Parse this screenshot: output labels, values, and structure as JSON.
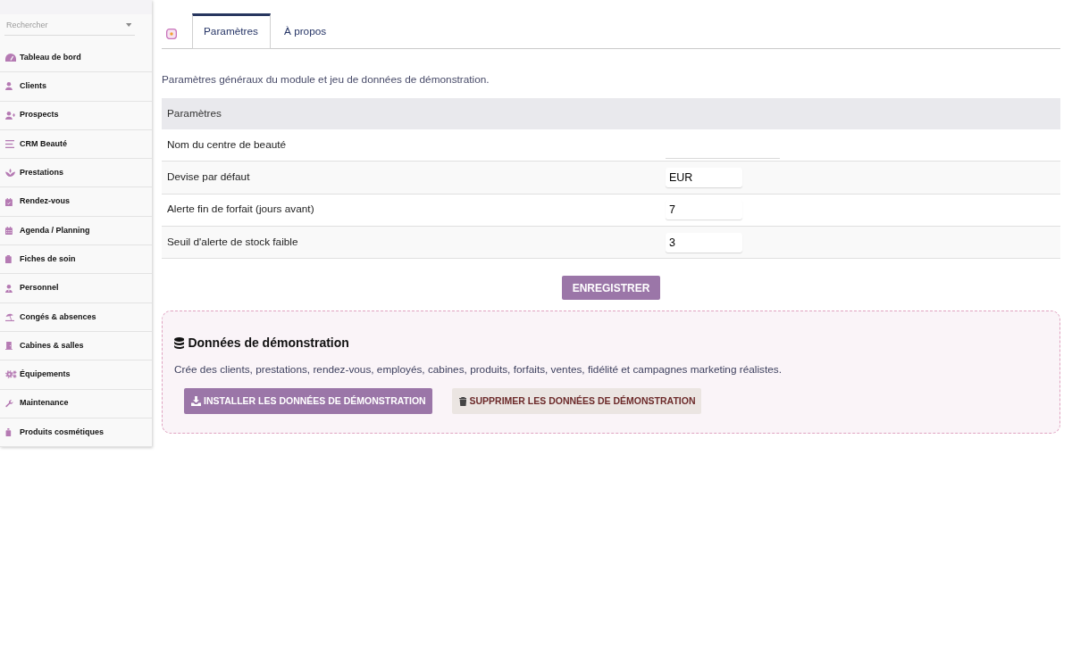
{
  "sidebar": {
    "search": {
      "placeholder": "Rechercher"
    },
    "items": [
      {
        "label": "Tableau de bord",
        "selected": false
      },
      {
        "label": "Clients",
        "selected": false
      },
      {
        "label": "Prospects",
        "selected": false
      },
      {
        "label": "CRM Beauté",
        "selected": false
      },
      {
        "label": "Prestations",
        "selected": false
      },
      {
        "label": "Rendez-vous",
        "selected": false
      },
      {
        "label": "Agenda / Planning",
        "selected": false
      },
      {
        "label": "Fiches de soin",
        "selected": false
      },
      {
        "label": "Personnel",
        "selected": false
      },
      {
        "label": "Congés & absences",
        "selected": false
      },
      {
        "label": "Cabines & salles",
        "selected": false
      },
      {
        "label": "Équipements",
        "selected": false
      },
      {
        "label": "Maintenance",
        "selected": false
      },
      {
        "label": "Produits cosmétiques",
        "selected": false
      }
    ]
  },
  "tabs": [
    {
      "label": "Paramètres",
      "selected": true
    },
    {
      "label": "À propos",
      "selected": false
    }
  ],
  "intro": "Paramètres généraux du module et jeu de données de démonstration.",
  "settings_table": {
    "header": "Paramètres",
    "rows": [
      {
        "label": "Nom du centre de beauté",
        "kind": "text"
      },
      {
        "label": "Devise par défaut",
        "kind": "short",
        "value": "EUR"
      },
      {
        "label": "Alerte fin de forfait (jours avant)",
        "kind": "short",
        "value": "7"
      },
      {
        "label": "Seuil d'alerte de stock faible",
        "kind": "short",
        "value": "3"
      }
    ]
  },
  "save_button": {
    "label": "ENREGISTRER"
  },
  "demo_data": {
    "title": "Données de démonstration",
    "description": "Crée des clients, prestations, rendez-vous, employés, cabines, produits, forfaits, ventes, fidélité et campagnes marketing réalistes.",
    "buttons": [
      {
        "label": "INSTALLER LES DONNÉES DE DÉMONSTRATION",
        "kind": "install"
      },
      {
        "label": "SUPPRIMER LES DONNÉES DE DÉMONSTRATION",
        "kind": "delete"
      }
    ]
  }
}
